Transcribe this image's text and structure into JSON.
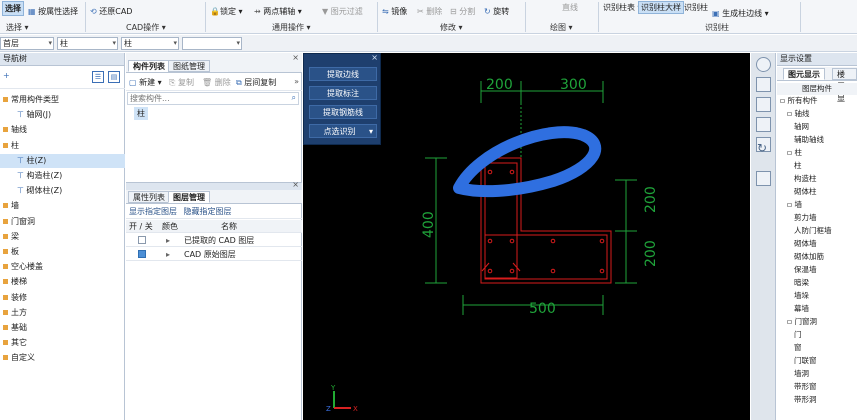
{
  "ribbon": {
    "select_label": "选择",
    "select_group": "选择",
    "attr_select": "按属性选择",
    "restore_cad": "还原CAD",
    "cad_group": "CAD操作",
    "lock": "锁定",
    "two_point_aux": "两点辅轴",
    "layer_filter": "图元过滤",
    "common_group": "通用操作",
    "mirror": "镜像",
    "rotate": "旋转",
    "split": "分割",
    "delete": "删除",
    "modify_group": "修改",
    "draw_group": "绘图",
    "line": "直线",
    "identify_column_table": "识别柱表",
    "identify_column_large": "识别柱大样",
    "identify_column": "识别柱",
    "generate_column_edge": "生成柱边线",
    "identify_column_group": "识别柱"
  },
  "combo_bar": {
    "floor": "首层",
    "type1": "柱",
    "type2": "柱",
    "type3": ""
  },
  "left_panel": {
    "title": "导航树",
    "items": [
      {
        "label": "常用构件类型",
        "indent": 0,
        "folder": true
      },
      {
        "label": "轴网(J)",
        "indent": 1,
        "folder": false
      },
      {
        "label": "轴线",
        "indent": 0,
        "folder": true
      },
      {
        "label": "柱",
        "indent": 0,
        "folder": true
      },
      {
        "label": "柱(Z)",
        "indent": 1,
        "folder": false,
        "selected": true
      },
      {
        "label": "构造柱(Z)",
        "indent": 1,
        "folder": false
      },
      {
        "label": "砌体柱(Z)",
        "indent": 1,
        "folder": false
      },
      {
        "label": "墙",
        "indent": 0,
        "folder": true
      },
      {
        "label": "门窗洞",
        "indent": 0,
        "folder": true
      },
      {
        "label": "梁",
        "indent": 0,
        "folder": true
      },
      {
        "label": "板",
        "indent": 0,
        "folder": true
      },
      {
        "label": "空心楼盖",
        "indent": 0,
        "folder": true
      },
      {
        "label": "楼梯",
        "indent": 0,
        "folder": true
      },
      {
        "label": "装修",
        "indent": 0,
        "folder": true
      },
      {
        "label": "土方",
        "indent": 0,
        "folder": true
      },
      {
        "label": "基础",
        "indent": 0,
        "folder": true
      },
      {
        "label": "其它",
        "indent": 0,
        "folder": true
      },
      {
        "label": "自定义",
        "indent": 0,
        "folder": true
      }
    ]
  },
  "mid_panel": {
    "tab_components": "构件列表",
    "tab_drawings": "图纸管理",
    "new_label": "新建",
    "copy_label": "复制",
    "delete_label": "删除",
    "layer_copy_label": "层间复制",
    "search_placeholder": "搜索构件...",
    "component_item": "柱",
    "tab_attr": "属性列表",
    "tab_layer": "图层管理",
    "show_layer": "显示指定图层",
    "hide_layer": "隐藏指定图层",
    "col_onoff": "开 / 关",
    "col_color": "颜色",
    "col_name": "名称",
    "layer_rows": [
      {
        "checked": false,
        "name": "已提取的 CAD 图层"
      },
      {
        "checked": true,
        "name": "CAD 原始图层"
      }
    ]
  },
  "float_menu": {
    "btn1": "提取边线",
    "btn2": "提取标注",
    "btn3": "提取钢筋线",
    "btn4": "点选识别"
  },
  "drawing": {
    "dim_top_left": "200",
    "dim_top_right": "300",
    "dim_left": "400",
    "dim_right_top": "200",
    "dim_right_bottom": "200",
    "dim_bottom": "500"
  },
  "right_panel": {
    "title": "显示设置",
    "tab1": "图元显示",
    "tab2": "楼层显",
    "col_header": "图层构件",
    "items": [
      {
        "label": "所有构件",
        "level": 0,
        "group": true
      },
      {
        "label": "轴线",
        "level": 1,
        "group": true
      },
      {
        "label": "轴网",
        "level": 2
      },
      {
        "label": "辅助轴线",
        "level": 2
      },
      {
        "label": "柱",
        "level": 1,
        "group": true
      },
      {
        "label": "柱",
        "level": 2
      },
      {
        "label": "构造柱",
        "level": 2
      },
      {
        "label": "砌体柱",
        "level": 2
      },
      {
        "label": "墙",
        "level": 1,
        "group": true
      },
      {
        "label": "剪力墙",
        "level": 2
      },
      {
        "label": "人防门框墙",
        "level": 2
      },
      {
        "label": "砌体墙",
        "level": 2
      },
      {
        "label": "砌体加筋",
        "level": 2
      },
      {
        "label": "保温墙",
        "level": 2
      },
      {
        "label": "暗梁",
        "level": 2
      },
      {
        "label": "墙垛",
        "level": 2
      },
      {
        "label": "幕墙",
        "level": 2
      },
      {
        "label": "门窗洞",
        "level": 1,
        "group": true
      },
      {
        "label": "门",
        "level": 2
      },
      {
        "label": "窗",
        "level": 2
      },
      {
        "label": "门联窗",
        "level": 2
      },
      {
        "label": "墙洞",
        "level": 2
      },
      {
        "label": "带形窗",
        "level": 2
      },
      {
        "label": "带形洞",
        "level": 2
      }
    ]
  }
}
